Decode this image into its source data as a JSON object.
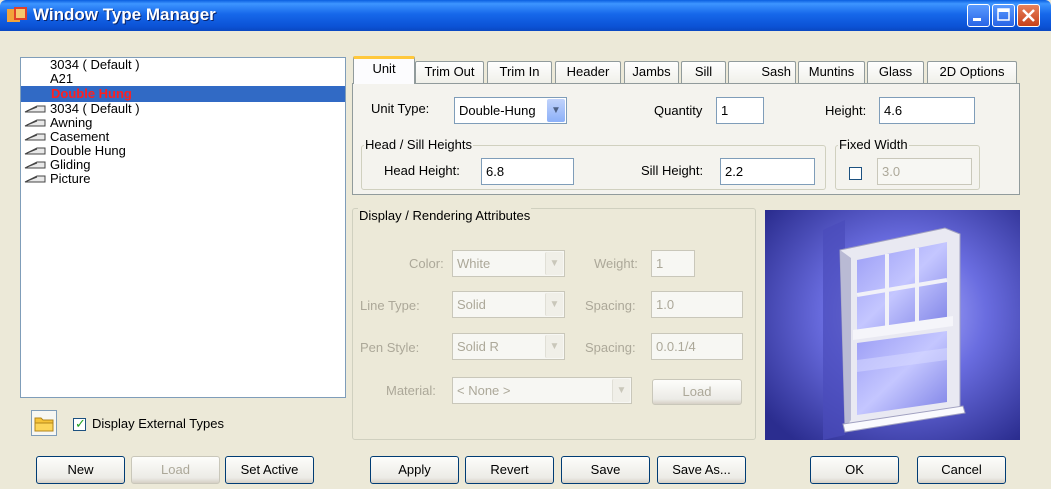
{
  "window": {
    "title": "Window Type Manager"
  },
  "type_list": {
    "items": [
      {
        "label": "3034 ( Default )",
        "icon": "",
        "selected": false
      },
      {
        "label": "A21",
        "icon": "",
        "selected": false
      },
      {
        "label": "Double Hung",
        "icon": "",
        "selected": true
      },
      {
        "label": "3034 ( Default )",
        "icon": "window-type-icon",
        "selected": false
      },
      {
        "label": "Awning",
        "icon": "window-type-icon",
        "selected": false
      },
      {
        "label": "Casement",
        "icon": "window-type-icon",
        "selected": false
      },
      {
        "label": "Double Hung",
        "icon": "window-type-icon",
        "selected": false
      },
      {
        "label": "Gliding",
        "icon": "window-type-icon",
        "selected": false
      },
      {
        "label": "Picture",
        "icon": "window-type-icon",
        "selected": false
      }
    ]
  },
  "display_external": {
    "label": "Display External Types",
    "checked": true
  },
  "left_buttons": {
    "new": "New",
    "load": "Load",
    "set_active": "Set Active"
  },
  "tabs": [
    "Unit",
    "Trim Out",
    "Trim In",
    "Header",
    "Jambs",
    "Sill",
    "Sash",
    "Muntins",
    "Glass",
    "2D Options"
  ],
  "unit": {
    "unit_type_label": "Unit Type:",
    "unit_type_value": "Double-Hung",
    "quantity_label": "Quantity",
    "quantity_value": "1",
    "height_label": "Height:",
    "height_value": "4.6",
    "head_sill_title": "Head / Sill Heights",
    "head_height_label": "Head Height:",
    "head_height_value": "6.8",
    "sill_height_label": "Sill Height:",
    "sill_height_value": "2.2",
    "fixed_width_title": "Fixed Width",
    "fixed_width_checked": false,
    "fixed_width_value": "3.0"
  },
  "display_attrs": {
    "title": "Display / Rendering Attributes",
    "color_label": "Color:",
    "color_value": "White",
    "weight_label": "Weight:",
    "weight_value": "1",
    "line_type_label": "Line Type:",
    "line_type_value": "Solid",
    "spacing1_label": "Spacing:",
    "spacing1_value": "1.0",
    "pen_style_label": "Pen Style:",
    "pen_style_value": "Solid R",
    "spacing2_label": "Spacing:",
    "spacing2_value": "0.0.1/4",
    "material_label": "Material:",
    "material_value": "< None >",
    "load_label": "Load"
  },
  "bottom_buttons": {
    "apply": "Apply",
    "revert": "Revert",
    "save": "Save",
    "save_as": "Save As...",
    "ok": "OK",
    "cancel": "Cancel"
  },
  "colors": {
    "title_bar": "#0b52d6",
    "selection": "#316ac5",
    "selected_text": "#ff1f1f",
    "tab_accent": "#ffc83c"
  }
}
